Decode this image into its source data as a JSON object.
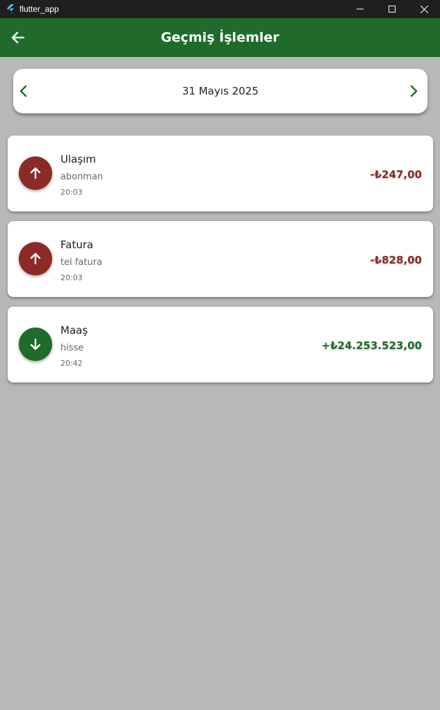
{
  "window": {
    "title": "flutter_app"
  },
  "appbar": {
    "title": "Geçmiş İşlemler",
    "back_icon": "arrow-left-icon",
    "color": "#1e6b2b"
  },
  "date_selector": {
    "date": "31 Mayıs 2025",
    "prev_icon": "chevron-left-icon",
    "next_icon": "chevron-right-icon"
  },
  "colors": {
    "expense": "#8b2a26",
    "income": "#1e6b2b",
    "background": "#b8b8b8"
  },
  "transactions": [
    {
      "title": "Ulaşım",
      "description": "abonman",
      "time": "20:03",
      "amount": "-₺247,00",
      "type": "expense",
      "icon": "arrow-up-icon"
    },
    {
      "title": "Fatura",
      "description": "tel fatura",
      "time": "20:03",
      "amount": "-₺828,00",
      "type": "expense",
      "icon": "arrow-up-icon"
    },
    {
      "title": "Maaş",
      "description": "hisse",
      "time": "20:42",
      "amount": "+₺24.253.523,00",
      "type": "income",
      "icon": "arrow-down-icon"
    }
  ]
}
